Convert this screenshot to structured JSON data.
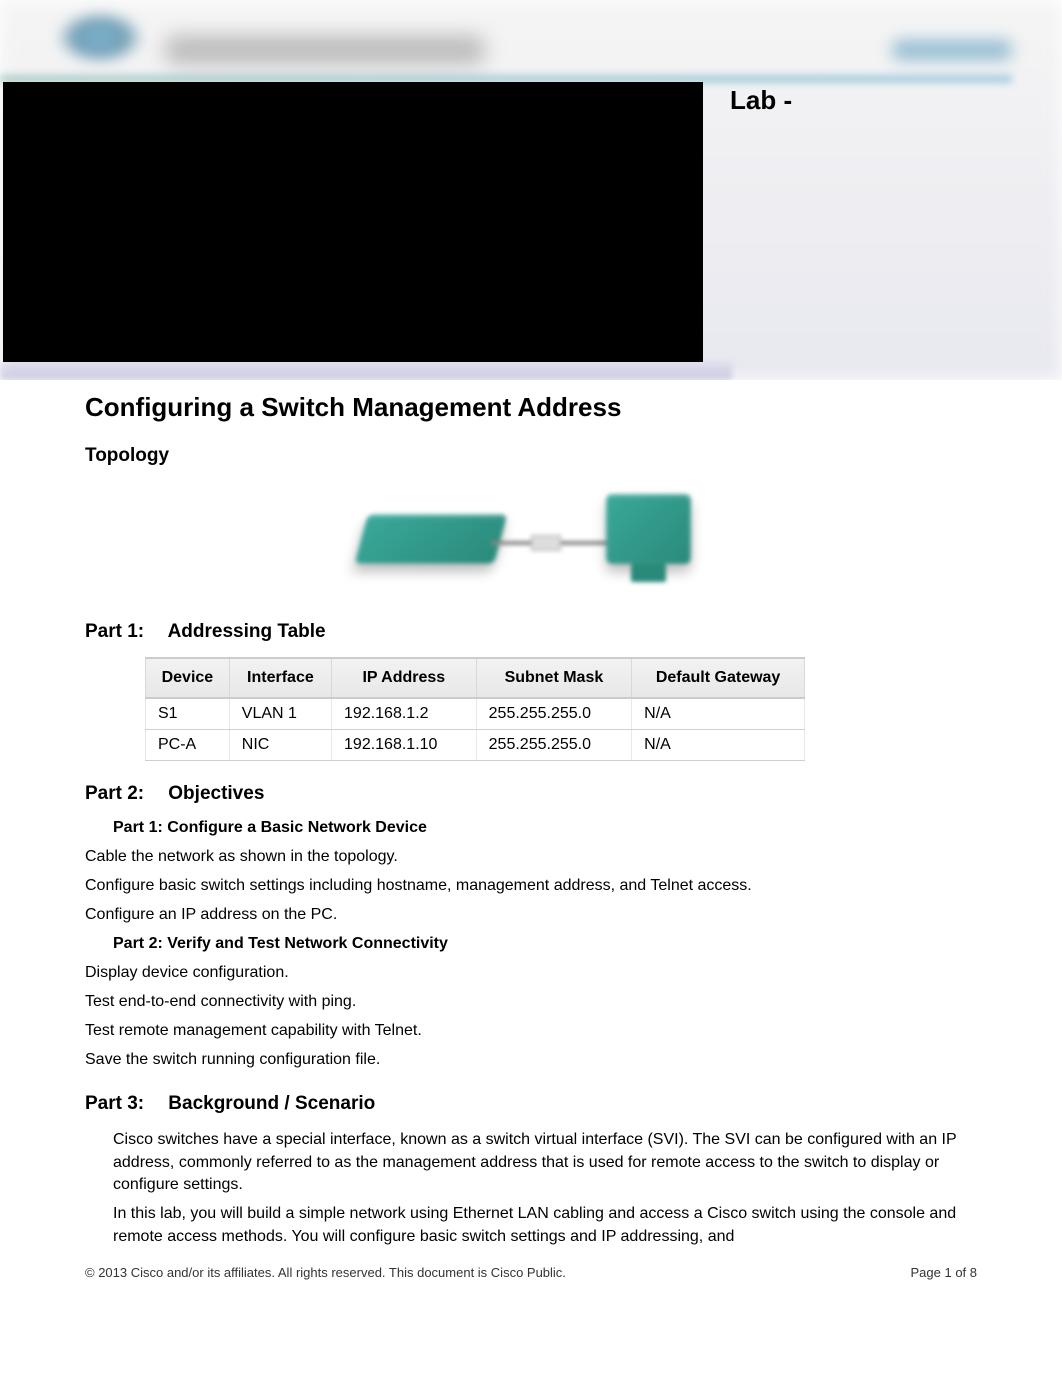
{
  "header": {
    "lab_label": "Lab -"
  },
  "title": "Configuring a Switch Management Address",
  "topology_heading": "Topology",
  "part1": {
    "label": "Part 1:",
    "title": "Addressing Table",
    "table": {
      "headers": [
        "Device",
        "Interface",
        "IP Address",
        "Subnet Mask",
        "Default Gateway"
      ],
      "rows": [
        [
          "S1",
          "VLAN 1",
          "192.168.1.2",
          "255.255.255.0",
          "N/A"
        ],
        [
          "PC-A",
          "NIC",
          "192.168.1.10",
          "255.255.255.0",
          "N/A"
        ]
      ]
    }
  },
  "part2": {
    "label": "Part 2:",
    "title": "Objectives",
    "sub1": "Part 1: Configure a Basic Network Device",
    "lines1": [
      "Cable the network as shown in the topology.",
      "Configure basic switch settings including hostname, management address, and Telnet access.",
      "Configure an IP address on the PC."
    ],
    "sub2": "Part 2: Verify and Test Network Connectivity",
    "lines2": [
      "Display device configuration.",
      "Test end-to-end connectivity with ping.",
      "Test remote management capability with Telnet.",
      "Save the switch running configuration file."
    ]
  },
  "part3": {
    "label": "Part 3:",
    "title": "Background / Scenario",
    "paras": [
      "Cisco switches have a special interface, known as a switch virtual interface (SVI). The SVI can be configured with an IP address, commonly referred to as the management address that is used for remote access to the switch to display or configure settings.",
      "In this lab, you will build a simple network using Ethernet LAN cabling and access a Cisco switch using the console and remote access methods. You will configure basic switch settings and IP addressing, and"
    ]
  },
  "footer": {
    "copyright": "© 2013 Cisco and/or its affiliates. All rights reserved. This document is Cisco Public.",
    "page": "Page 1 of 8"
  }
}
